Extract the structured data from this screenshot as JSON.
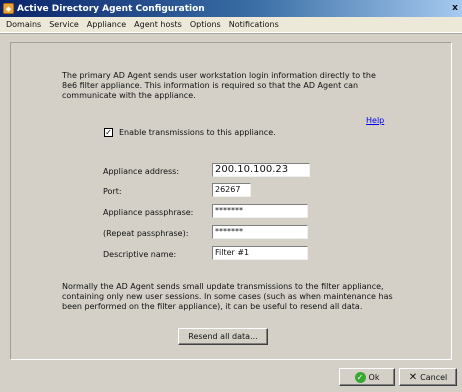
{
  "window": {
    "title": "Active Directory Agent Configuration",
    "close_glyph": "x"
  },
  "menu": [
    "Domains",
    "Service",
    "Appliance",
    "Agent hosts",
    "Options",
    "Notifications"
  ],
  "intro": "The primary AD Agent sends user workstation login information directly to the 8e6 filter appliance.  This information is required so that the AD Agent can communicate with the appliance.",
  "help_label": "Help",
  "enable": {
    "label": "Enable transmissions to this appliance.",
    "checked": true
  },
  "form": {
    "address_label": "Appliance address:",
    "address_value": "200.10.100.23",
    "port_label": "Port:",
    "port_value": "26267",
    "passphrase_label": "Appliance passphrase:",
    "passphrase_value": "*******",
    "repeat_label": "(Repeat passphrase):",
    "repeat_value": "*******",
    "name_label": "Descriptive name:",
    "name_value": "Filter #1"
  },
  "note": "Normally the AD Agent sends small update transmissions to the filter appliance, containing only new user sessions.  In some cases (such as when maintenance has been performed on the filter appliance), it can be useful to resend all data.",
  "resend_label": "Resend all data...",
  "ok_label": "Ok",
  "cancel_label": "Cancel",
  "colors": {
    "title_start": "#0a246a",
    "title_end": "#a6caf0",
    "link": "#0000ee",
    "ok_green": "#39a832"
  }
}
